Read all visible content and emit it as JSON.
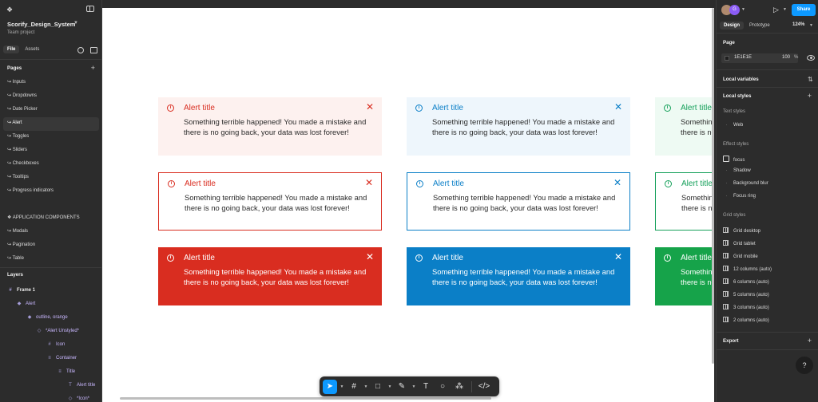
{
  "left_panel": {
    "project_name": "Scorify_Design_System",
    "project_sub": "Team project",
    "tabs": [
      "File",
      "Assets"
    ],
    "pages_title": "Pages",
    "pages": [
      "↪ Inputs",
      "↪ Dropdowns",
      "↪ Date Picker",
      "↪ Alert",
      "↪ Toggles",
      "↪ Sliders",
      "↪ Checkboxes",
      "↪ Tooltips",
      "↪ Progress indicators"
    ],
    "group_heading": "❖ APPLICATION COMPONENTS",
    "group_pages": [
      "↪ Modals",
      "↪ Pagination",
      "↪ Table"
    ],
    "layers_title": "Layers",
    "layers": [
      "Frame 1",
      "Alert",
      "outline, orange",
      "*Alert Unstyled*",
      "Icon",
      "Container",
      "Title",
      "Alert title",
      "*Icon*"
    ]
  },
  "alerts": {
    "title": "Alert title",
    "body": "Something terrible happened! You made a mistake and there is no going back, your data was lost forever!",
    "icon_glyph": "i",
    "close_glyph": "✕",
    "colors": {
      "red": "#d92d20",
      "blue": "#0b7fc7",
      "green": "#16a34a"
    }
  },
  "toolbar": {
    "tools": [
      "move-tool",
      "frame-tool",
      "shape-tool",
      "pen-tool",
      "text-tool",
      "comment-tool",
      "components-tool",
      "dev-mode-tool"
    ]
  },
  "right_panel": {
    "avatar_initial": "G",
    "share_label": "Share",
    "tabs": [
      "Design",
      "Prototype"
    ],
    "zoom": "124%",
    "page_title": "Page",
    "page_color": "1E1E1E",
    "page_opacity": "100",
    "page_opacity_unit": "%",
    "local_variables": "Local variables",
    "local_styles": "Local styles",
    "text_styles_title": "Text styles",
    "text_styles": [
      "Web"
    ],
    "effect_styles_title": "Effect styles",
    "effect_styles": [
      "focus",
      "Shadow",
      "Background blur",
      "Focus ring"
    ],
    "grid_styles_title": "Grid styles",
    "grid_styles": [
      "Grid desktop",
      "Grid tablet",
      "Grid mobile",
      "12 columns (auto)",
      "6 columns (auto)",
      "5 columns (auto)",
      "3 columns (auto)",
      "2 columns (auto)"
    ],
    "export_title": "Export",
    "help_glyph": "?"
  }
}
